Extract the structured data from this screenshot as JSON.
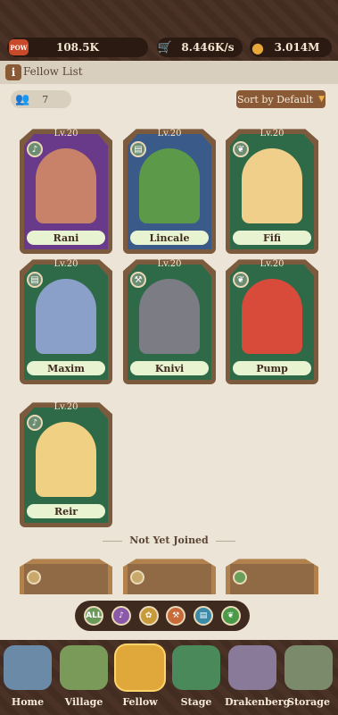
{
  "resources": [
    {
      "icon": "pow-icon",
      "glyph": "POW",
      "value": "108.5K"
    },
    {
      "icon": "cart-icon",
      "glyph": "🛒",
      "value": "8.446K/s"
    },
    {
      "icon": "coin-icon",
      "glyph": "●",
      "value": "3.014M"
    }
  ],
  "panel": {
    "title": "Fellow List",
    "count": "7",
    "sort_label": "Sort by Default"
  },
  "fellows": [
    {
      "level": "Lv.20",
      "name": "Rani",
      "type_icon": "lyre-icon",
      "bg": "#6a3a8a",
      "portrait": "#c9826a"
    },
    {
      "level": "Lv.20",
      "name": "Lincale",
      "type_icon": "book-icon",
      "bg": "#3a5a8a",
      "portrait": "#5c9a4a"
    },
    {
      "level": "Lv.20",
      "name": "Fifi",
      "type_icon": "leaf-icon",
      "bg": "#2f6a48",
      "portrait": "#f0cf8a"
    },
    {
      "level": "Lv.20",
      "name": "Maxim",
      "type_icon": "book-icon",
      "bg": "#2f6a48",
      "portrait": "#8aa0c8"
    },
    {
      "level": "Lv.20",
      "name": "Knivi",
      "type_icon": "hammer-icon",
      "bg": "#2f6a48",
      "portrait": "#7c7c84"
    },
    {
      "level": "Lv.20",
      "name": "Pump",
      "type_icon": "leaf-icon",
      "bg": "#2f6a48",
      "portrait": "#d84a3a"
    },
    {
      "level": "Lv.20",
      "name": "Reir",
      "type_icon": "lyre-icon",
      "bg": "#2f6a48",
      "portrait": "#f0d082"
    }
  ],
  "not_joined_label": "Not Yet Joined",
  "filters": [
    {
      "name": "filter-all",
      "label": "ALL",
      "color": "#6a9a5a"
    },
    {
      "name": "filter-lyre",
      "label": "♪",
      "color": "#8a5aa8"
    },
    {
      "name": "filter-paw",
      "label": "✿",
      "color": "#c89a3a"
    },
    {
      "name": "filter-hammer",
      "label": "⚒",
      "color": "#c86a3a"
    },
    {
      "name": "filter-book",
      "label": "▤",
      "color": "#3a8aa8"
    },
    {
      "name": "filter-leaf",
      "label": "❦",
      "color": "#4a9a4a"
    }
  ],
  "nav": [
    {
      "name": "Home",
      "color": "#6a8aa8"
    },
    {
      "name": "Village",
      "color": "#7a9a5a"
    },
    {
      "name": "Fellow",
      "color": "#e0a83a"
    },
    {
      "name": "Stage",
      "color": "#4a8a5a"
    },
    {
      "name": "Drakenberg",
      "color": "#8a7a9a"
    },
    {
      "name": "Storage",
      "color": "#7a8a6a"
    }
  ],
  "active_nav": "Fellow"
}
